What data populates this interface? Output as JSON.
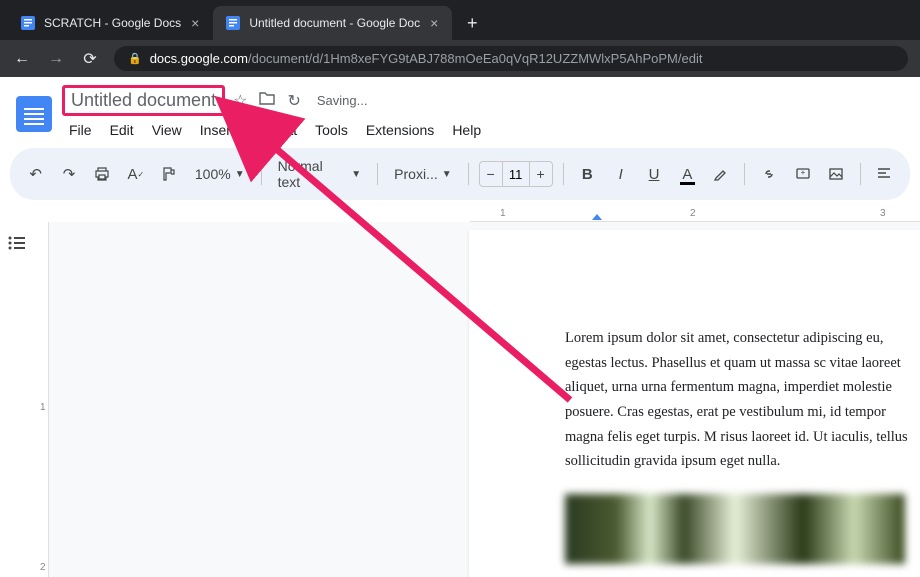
{
  "browser": {
    "tabs": [
      {
        "title": "SCRATCH - Google Docs",
        "active": false
      },
      {
        "title": "Untitled document - Google Doc",
        "active": true
      }
    ],
    "url_host": "docs.google.com",
    "url_path": "/document/d/1Hm8xeFYG9tABJ788mOeEa0qVqR12UZZMWlxP5AhPoPM/edit"
  },
  "header": {
    "doc_title": "Untitled document",
    "saving_label": "Saving...",
    "menu": [
      "File",
      "Edit",
      "View",
      "Insert",
      "Format",
      "Tools",
      "Extensions",
      "Help"
    ]
  },
  "toolbar": {
    "zoom": "100%",
    "style": "Normal text",
    "font": "Proxi...",
    "font_size": "11"
  },
  "ruler": {
    "h_ticks": [
      "1",
      "2",
      "3"
    ],
    "v_ticks": [
      "1",
      "2"
    ]
  },
  "document": {
    "body": "Lorem ipsum dolor sit amet, consectetur adipiscing eu, egestas lectus. Phasellus et quam ut massa sc vitae laoreet aliquet, urna urna fermentum magna, imperdiet molestie posuere. Cras egestas, erat pe vestibulum mi, id tempor magna felis eget turpis. M risus laoreet id. Ut iaculis, tellus sollicitudin gravida ipsum eget nulla."
  }
}
